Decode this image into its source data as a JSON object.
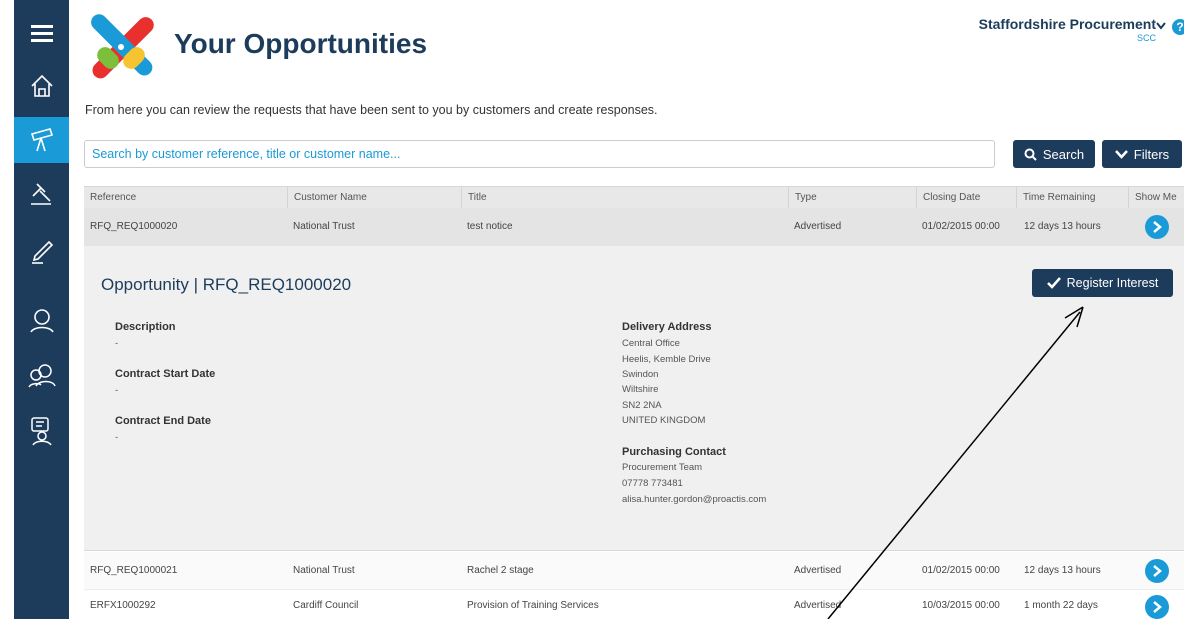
{
  "app": {
    "title": "Your Opportunities"
  },
  "user": {
    "name": "Staffordshire Procurement",
    "org": "SCC"
  },
  "intro": "From here you can review the requests that have been sent to you by customers and create responses.",
  "search": {
    "placeholder": "Search by customer reference, title or customer name...",
    "search_label": "Search",
    "filters_label": "Filters"
  },
  "columns": [
    "Reference",
    "Customer Name",
    "Title",
    "Type",
    "Closing Date",
    "Time Remaining",
    "Show Me"
  ],
  "rows": [
    {
      "reference": "RFQ_REQ1000020",
      "customer": "National Trust",
      "title": "test notice",
      "type": "Advertised",
      "closing": "01/02/2015 00:00",
      "remaining": "12 days 13 hours"
    },
    {
      "reference": "RFQ_REQ1000021",
      "customer": "National Trust",
      "title": "Rachel 2 stage",
      "type": "Advertised",
      "closing": "01/02/2015 00:00",
      "remaining": "12 days 13 hours"
    },
    {
      "reference": "ERFX1000292",
      "customer": "Cardiff Council",
      "title": "Provision of Training Services",
      "type": "Advertised",
      "closing": "10/03/2015 00:00",
      "remaining": "1 month 22 days"
    }
  ],
  "detail": {
    "title": "Opportunity | RFQ_REQ1000020",
    "register_label": "Register Interest",
    "description_label": "Description",
    "description_value": "-",
    "start_label": "Contract Start Date",
    "start_value": "-",
    "end_label": "Contract End Date",
    "end_value": "-",
    "delivery_label": "Delivery Address",
    "delivery_lines": [
      "Central Office",
      "Heelis, Kemble Drive",
      "Swindon",
      "Wiltshire",
      "SN2 2NA",
      "UNITED KINGDOM"
    ],
    "contact_label": "Purchasing Contact",
    "contact_lines": [
      "Procurement Team",
      "07778 773481",
      "alisa.hunter.gordon@proactis.com"
    ]
  },
  "colors": {
    "navy": "#1d3c5c",
    "accent": "#1a9ad6"
  },
  "icons": [
    "menu-icon",
    "home-icon",
    "telescope-icon",
    "gavel-icon",
    "pen-icon",
    "user-icon",
    "users-icon",
    "chat-user-icon",
    "search-icon",
    "chevron-down-icon",
    "check-icon",
    "arrow-right-icon",
    "help-icon"
  ]
}
